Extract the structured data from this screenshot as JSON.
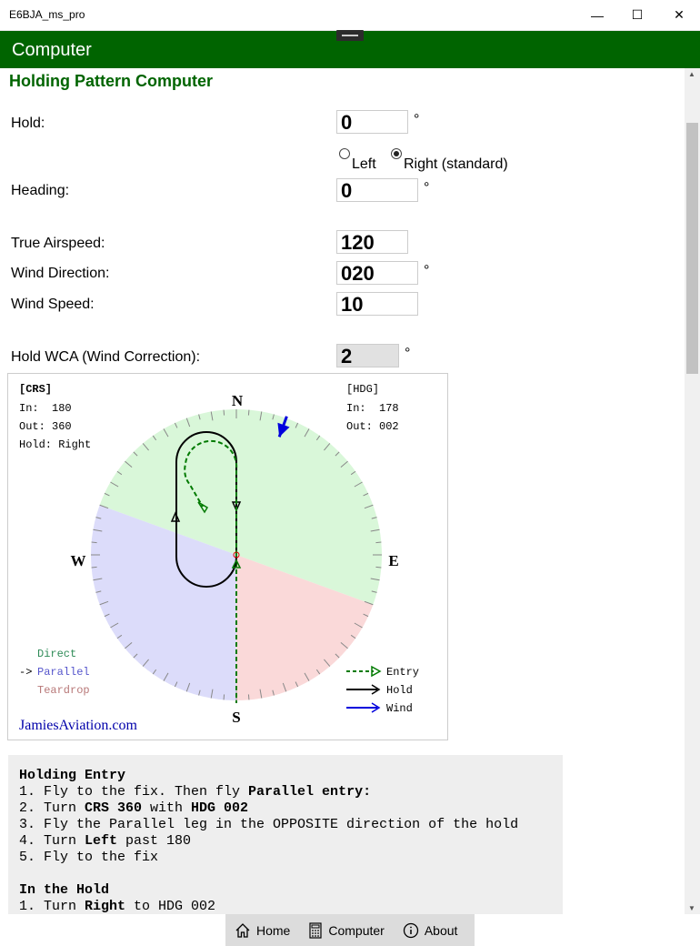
{
  "window": {
    "title": "E6BJA_ms_pro",
    "min": "—",
    "max": "☐",
    "close": "✕"
  },
  "header": {
    "title": "Computer"
  },
  "page": {
    "title": "Holding Pattern Computer"
  },
  "fields": {
    "hold": {
      "label": "Hold:",
      "value": "0",
      "unit": "°"
    },
    "turn": {
      "left": "Left",
      "right": "Right (standard)",
      "selected": "right"
    },
    "heading": {
      "label": "Heading:",
      "value": "0",
      "unit": "°"
    },
    "tas": {
      "label": "True Airspeed:",
      "value": "120"
    },
    "wind_dir": {
      "label": "Wind Direction:",
      "value": "020",
      "unit": "°"
    },
    "wind_speed": {
      "label": "Wind Speed:",
      "value": "10"
    },
    "wca": {
      "label": "Hold WCA (Wind Correction):",
      "value": "2",
      "unit": "°"
    }
  },
  "diagram": {
    "crs_title": "[CRS]",
    "crs_in": "In:  180",
    "crs_out": "Out: 360",
    "crs_hold": "Hold: Right",
    "hdg_title": "[HDG]",
    "hdg_in": "In:  178",
    "hdg_out": "Out: 002",
    "north": "N",
    "south": "S",
    "east": "E",
    "west": "W",
    "entry_direct": "Direct",
    "entry_parallel_marker": "->",
    "entry_parallel": "Parallel",
    "entry_teardrop": "Teardrop",
    "legend_entry": "Entry",
    "legend_hold": "Hold",
    "legend_wind": "Wind",
    "brand": "JamiesAviation.com",
    "wind_from_deg": 20,
    "colors": {
      "direct": "#d9f7d9",
      "parallel": "#dcdcfa",
      "teardrop": "#fad9d9",
      "entry": "#007a00",
      "hold": "#000000",
      "wind": "#0000dd",
      "direct_text": "#2e8b57",
      "parallel_text": "#5555cc",
      "teardrop_text": "#b87878"
    }
  },
  "instructions": {
    "lines": [
      [
        {
          "t": "Holding Entry",
          "b": true
        }
      ],
      [
        {
          "t": "1. Fly to the fix. Then fly ",
          "b": false
        },
        {
          "t": "Parallel entry:",
          "b": true
        }
      ],
      [
        {
          "t": "2. Turn ",
          "b": false
        },
        {
          "t": "CRS 360",
          "b": true
        },
        {
          "t": " with ",
          "b": false
        },
        {
          "t": "HDG 002",
          "b": true
        }
      ],
      [
        {
          "t": "3. Fly the Parallel leg in the OPPOSITE direction of the hold",
          "b": false
        }
      ],
      [
        {
          "t": "4. Turn ",
          "b": false
        },
        {
          "t": "Left",
          "b": true
        },
        {
          "t": " past 180",
          "b": false
        }
      ],
      [
        {
          "t": "5. Fly to the fix",
          "b": false
        }
      ],
      [
        {
          "t": " ",
          "b": false
        }
      ],
      [
        {
          "t": "In the Hold",
          "b": true
        }
      ],
      [
        {
          "t": "1. Turn ",
          "b": false
        },
        {
          "t": "Right",
          "b": true
        },
        {
          "t": " to HDG 002",
          "b": false
        }
      ]
    ]
  },
  "nav": {
    "home": "Home",
    "computer": "Computer",
    "about": "About"
  }
}
